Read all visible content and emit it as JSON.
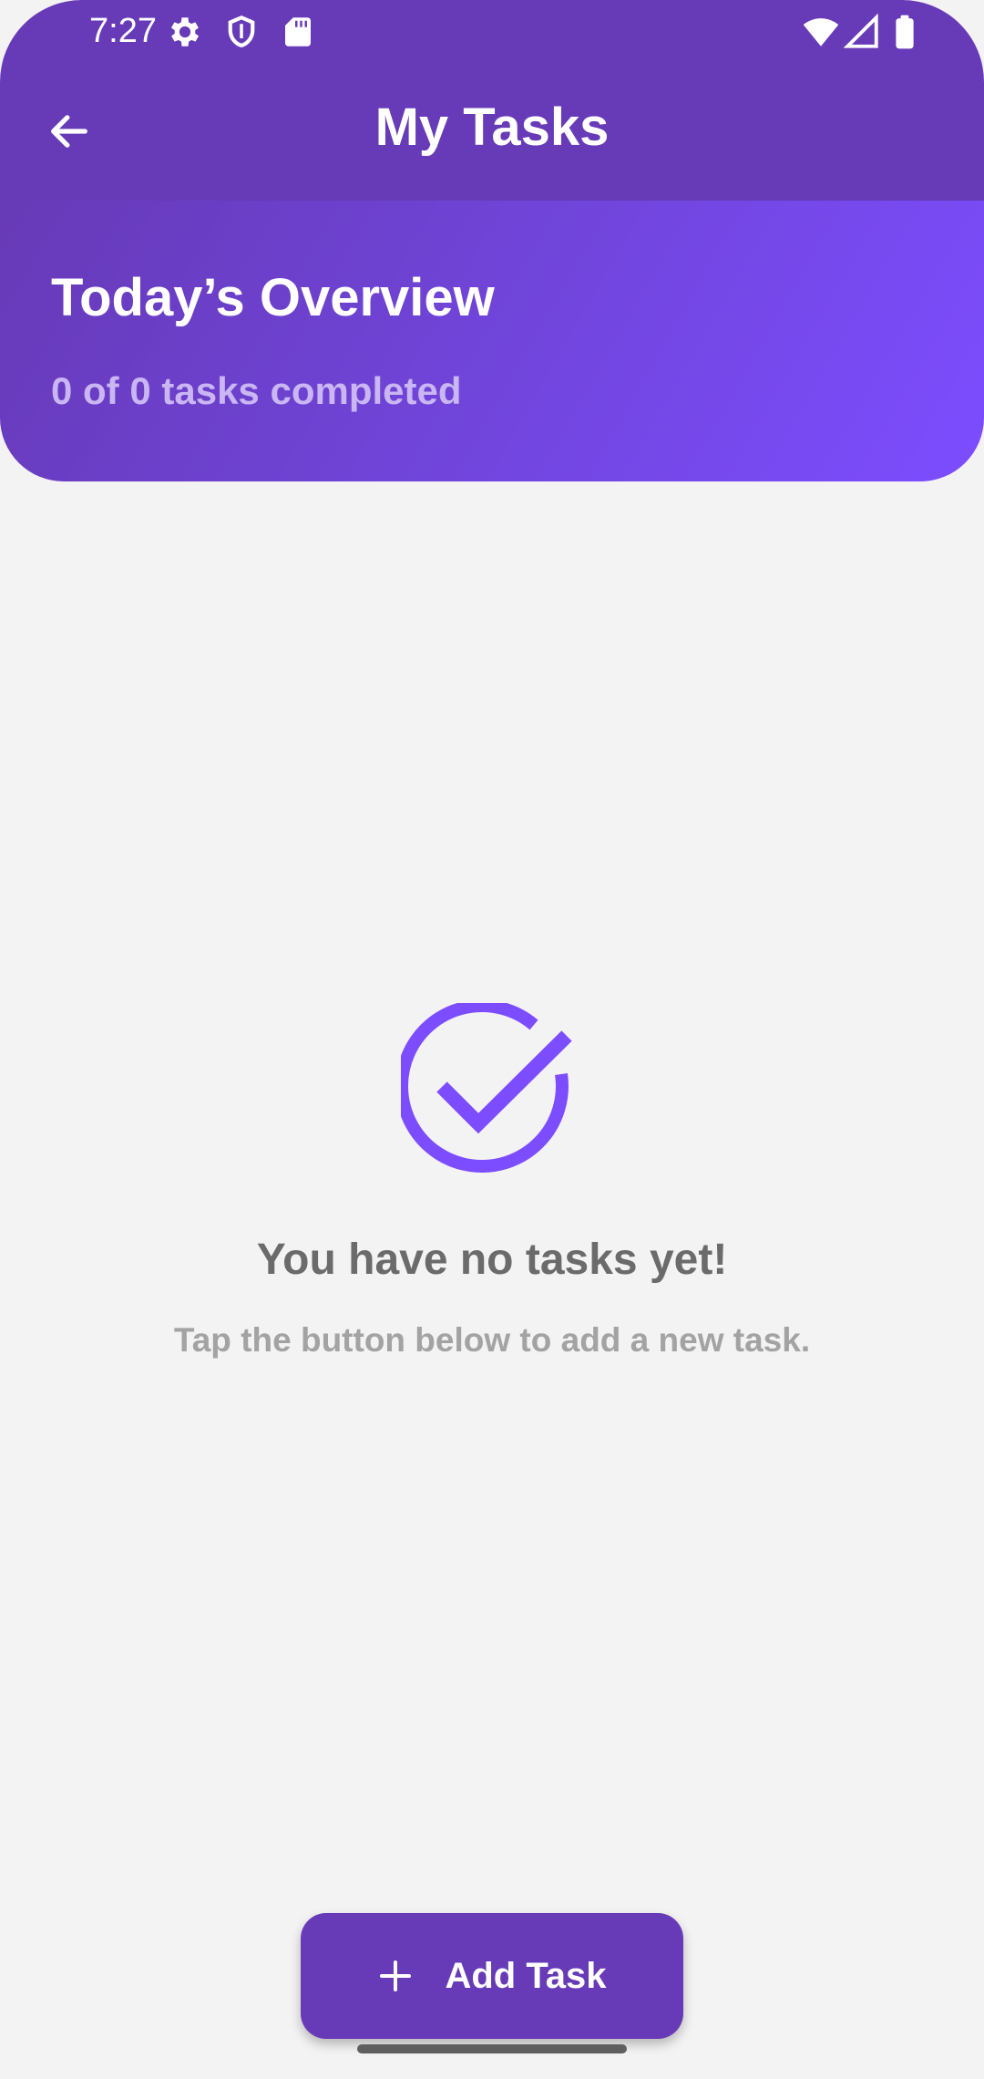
{
  "status_bar": {
    "time": "7:27",
    "icons": [
      "settings-icon",
      "shield-icon",
      "sd-card-icon",
      "wifi-icon",
      "signal-icon",
      "battery-icon"
    ]
  },
  "app_bar": {
    "title": "My Tasks",
    "back_icon": "arrow-back-icon"
  },
  "overview": {
    "title": "Today’s Overview",
    "subtitle": "0 of 0 tasks completed"
  },
  "empty_state": {
    "icon": "check-circle-icon",
    "title": "You have no tasks yet!",
    "subtitle": "Tap the button below to add a new task."
  },
  "add_button": {
    "icon": "plus-icon",
    "label": "Add Task"
  },
  "colors": {
    "primary": "#673ab7",
    "accent": "#7c4dff",
    "background": "#f4f3f4",
    "empty_title": "#6b6b6b",
    "empty_subtitle": "#a3a3a3",
    "overview_subtitle": "#c9b6f3"
  }
}
